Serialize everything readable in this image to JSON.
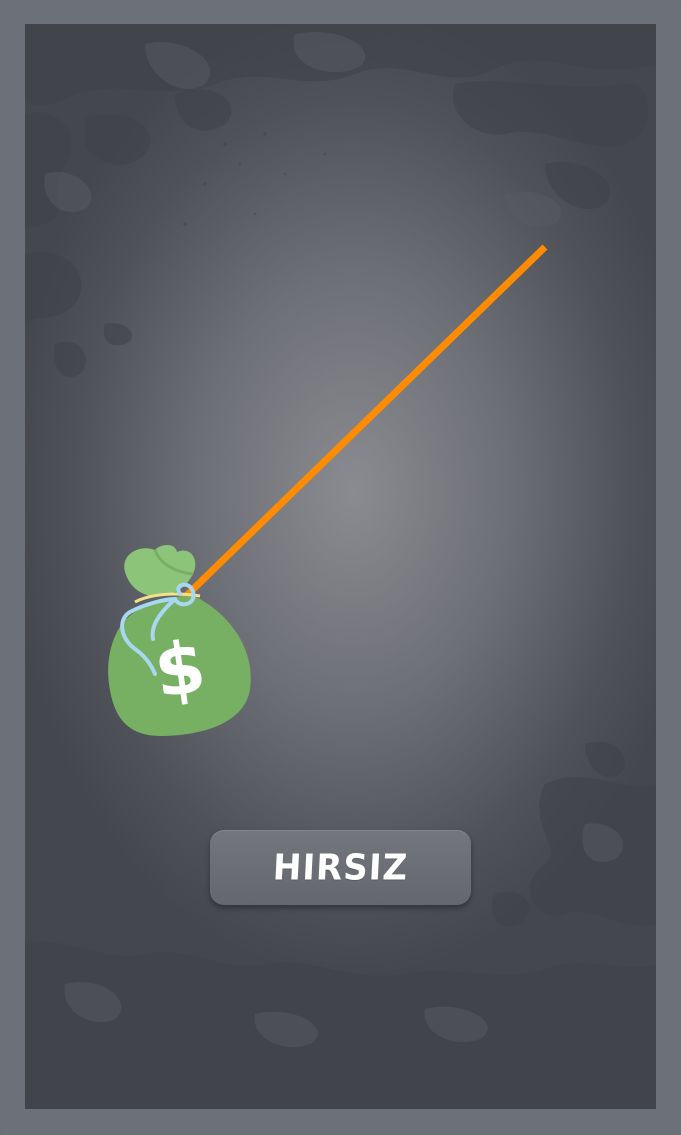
{
  "game": {
    "action_button_label": "HIRSIZ",
    "bag_symbol": "$"
  },
  "colors": {
    "frame": "#6c7079",
    "rope": "#ff8c00",
    "bag_green": "#77b062",
    "bag_top": "#8cc57a",
    "string_blue": "#a8d8f0",
    "button_bg": "#6c6e75"
  },
  "icons": {
    "bag": "money-bag-icon",
    "rope": "rope-line"
  }
}
